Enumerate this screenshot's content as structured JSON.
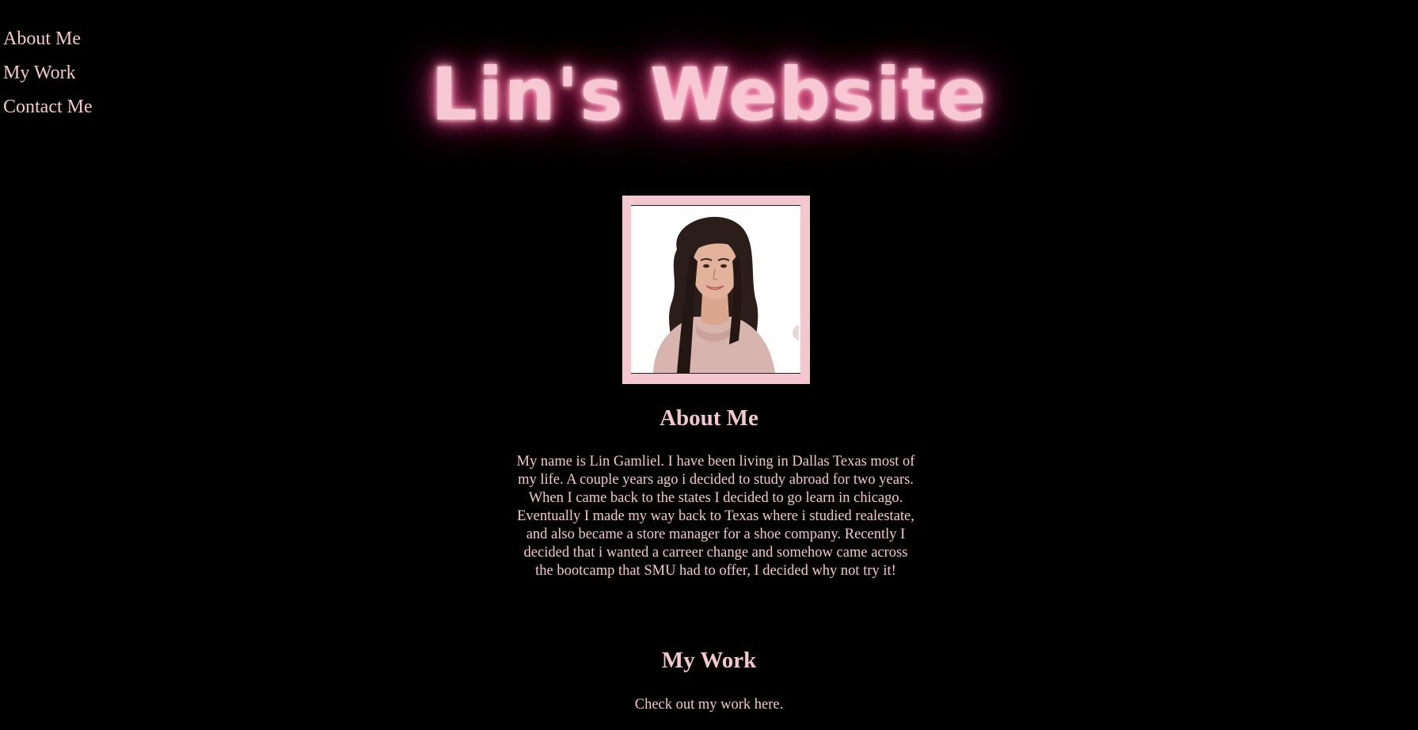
{
  "nav": {
    "items": [
      {
        "label": "About Me"
      },
      {
        "label": "My Work"
      },
      {
        "label": "Contact Me"
      }
    ]
  },
  "header": {
    "title": "Lin's Website"
  },
  "about": {
    "heading": "About Me",
    "text": "My name is Lin Gamliel. I have been living in Dallas Texas most of my life. A couple years ago i decided to study abroad for two years. When I came back to the states I decided to go learn in chicago. Eventually I made my way back to Texas where i studied realestate, and also became a store manager for a shoe company. Recently I decided that i wanted a carreer change and somehow came across the bootcamp that SMU had to offer, I decided why not try it!"
  },
  "work": {
    "heading": "My Work",
    "text": "Check out my work here."
  },
  "colors": {
    "background": "#000000",
    "accent": "#f4c7d0",
    "glow": "#e0457f"
  }
}
